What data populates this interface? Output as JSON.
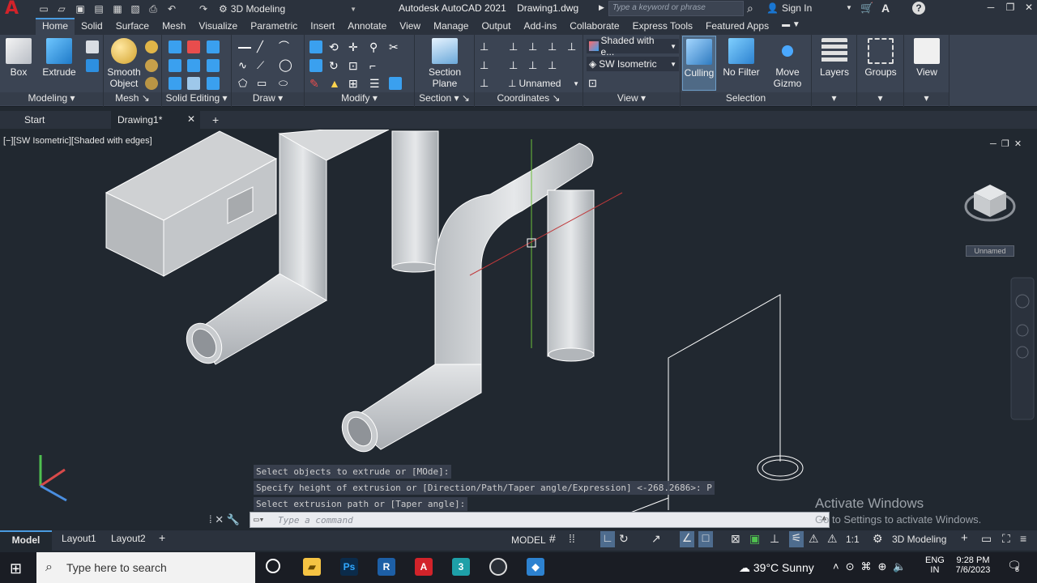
{
  "titlebar": {
    "workspace": "3D Modeling",
    "app_name": "Autodesk AutoCAD 2021",
    "file_name": "Drawing1.dwg",
    "search_placeholder": "Type a keyword or phrase",
    "sign_in": "Sign In"
  },
  "ribbon_tabs": [
    "Home",
    "Solid",
    "Surface",
    "Mesh",
    "Visualize",
    "Parametric",
    "Insert",
    "Annotate",
    "View",
    "Manage",
    "Output",
    "Add-ins",
    "Collaborate",
    "Express Tools",
    "Featured Apps"
  ],
  "ribbon": {
    "box": "Box",
    "extrude": "Extrude",
    "smooth_object": "Smooth Object",
    "section_plane": "Section Plane",
    "culling": "Culling",
    "no_filter": "No Filter",
    "move_gizmo": "Move Gizmo",
    "layers": "Layers",
    "groups": "Groups",
    "view": "View",
    "visual_style": "Shaded with e...",
    "view_dir": "SW Isometric",
    "ucs": "Unnamed",
    "panels": [
      "Modeling",
      "Mesh",
      "Solid Editing",
      "Draw",
      "Modify",
      "Section",
      "Coordinates",
      "View",
      "Selection"
    ]
  },
  "doc_tabs": {
    "start": "Start",
    "drawing": "Drawing1*"
  },
  "viewport": {
    "label": "[−][SW Isometric][Shaded with edges]",
    "viewcube_ucs": "Unnamed"
  },
  "command": {
    "history": [
      "Select objects to extrude or [MOde]:",
      "Specify height of extrusion or [Direction/Path/Taper angle/Expression] <-268.2686>: P",
      "Select extrusion path or [Taper angle]:"
    ],
    "placeholder": "Type a command"
  },
  "watermark": {
    "title": "Activate Windows",
    "subtitle": "Go to Settings to activate Windows."
  },
  "layout_tabs": [
    "Model",
    "Layout1",
    "Layout2"
  ],
  "status": {
    "model": "MODEL",
    "scale": "1:1",
    "workspace": "3D Modeling"
  },
  "taskbar": {
    "search_placeholder": "Type here to search",
    "weather": "39°C  Sunny",
    "lang": "ENG",
    "lang2": "IN",
    "time": "9:28 PM",
    "date": "7/6/2023",
    "notifications": "8"
  },
  "colors": {
    "accent": "#4a9be0",
    "autocad_red": "#d2232a",
    "viewport_bg": "#212830",
    "ribbon_bg": "#3b4453"
  }
}
